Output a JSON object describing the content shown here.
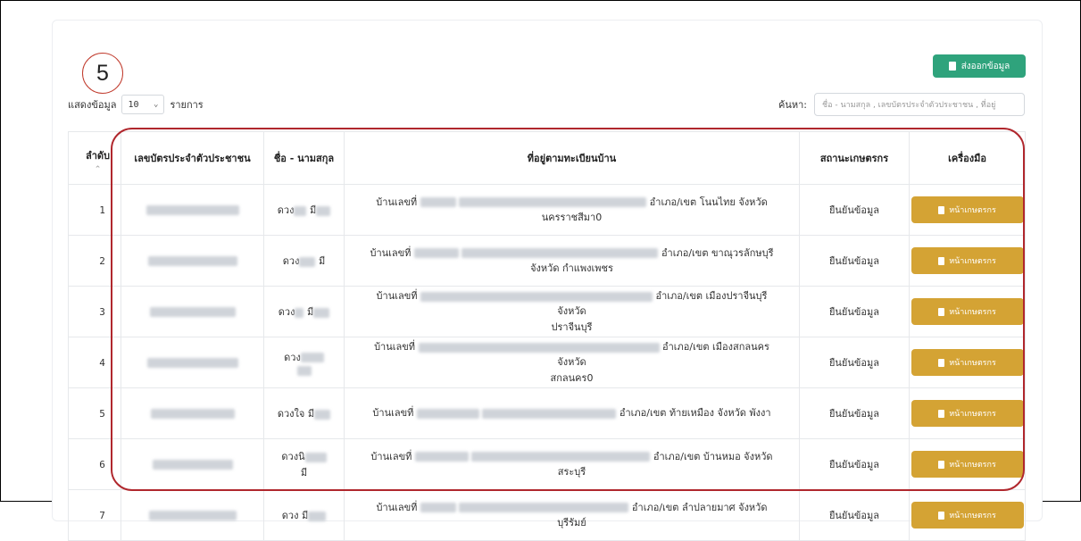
{
  "step_number": "5",
  "export_button": {
    "label": "ส่งออกข้อมูล",
    "icon": "document-icon"
  },
  "length": {
    "prefix": "แสดงข้อมูล",
    "value": "10",
    "suffix": "รายการ"
  },
  "search": {
    "label": "ค้นหา:",
    "placeholder": "ชื่อ - นามสกุล , เลขบัตรประจำตัวประชาชน , ที่อยู่"
  },
  "table": {
    "headers": {
      "index": "ลำดับ",
      "id_card": "เลขบัตรประจำตัวประชาชน",
      "name": "ชื่อ - นามสกุล",
      "address": "ที่อยู่ตามทะเบียนบ้าน",
      "status": "สถานะเกษตรกร",
      "tools": "เครื่องมือ"
    },
    "rows": [
      {
        "index": "1",
        "name": "ดวง",
        "name_tail": "มี",
        "address_start": "บ้านเลขที่",
        "address_end": "อำเภอ/เขต โนนไทย จังหวัด",
        "address_line2": "นครราชสีมา0",
        "status": "ยืนยันข้อมูล",
        "action": "หน้าเกษตรกร"
      },
      {
        "index": "2",
        "name": "ดวง",
        "name_tail": "มี",
        "address_start": "บ้านเลขที่",
        "address_end": "อำเภอ/เขต ขาณุวรลักษบุรี",
        "address_line2": "จังหวัด กำแพงเพชร",
        "status": "ยืนยันข้อมูล",
        "action": "หน้าเกษตรกร"
      },
      {
        "index": "3",
        "name": "ดวง",
        "name_tail": "มี",
        "address_start": "บ้านเลขที่",
        "address_end": "อำเภอ/เขต เมืองปราจีนบุรี จังหวัด",
        "address_line2": "ปราจีนบุรี",
        "status": "ยืนยันข้อมูล",
        "action": "หน้าเกษตรกร"
      },
      {
        "index": "4",
        "name": "ดวง",
        "name_tail": "",
        "address_start": "บ้านเลขที่",
        "address_end": "อำเภอ/เขต เมืองสกลนคร จังหวัด",
        "address_line2": "สกลนคร0",
        "status": "ยืนยันข้อมูล",
        "action": "หน้าเกษตรกร"
      },
      {
        "index": "5",
        "name": "ดวงใจ",
        "name_tail": "มี",
        "address_start": "บ้านเลขที่",
        "address_end": "อำเภอ/เขต ท้ายเหมือง จังหวัด พังงา",
        "address_line2": "",
        "status": "ยืนยันข้อมูล",
        "action": "หน้าเกษตรกร"
      },
      {
        "index": "6",
        "name": "ดวงนิ",
        "name_tail": "มี",
        "address_start": "บ้านเลขที่",
        "address_end": "อำเภอ/เขต บ้านหมอ จังหวัด สระบุรี",
        "address_line2": "",
        "status": "ยืนยันข้อมูล",
        "action": "หน้าเกษตรกร"
      },
      {
        "index": "7",
        "name": "ดวง",
        "name_tail": "มี",
        "address_start": "บ้านเลขที่",
        "address_end": "อำเภอ/เขต ลำปลายมาศ จังหวัด บุรีรัมย์",
        "address_line2": "",
        "status": "ยืนยันข้อมูล",
        "action": "หน้าเกษตรกร"
      }
    ]
  },
  "colors": {
    "accent_green": "#2fa37c",
    "action_gold": "#d4a334",
    "status_green": "#3a9d2e",
    "highlight_red": "#b0272d"
  }
}
